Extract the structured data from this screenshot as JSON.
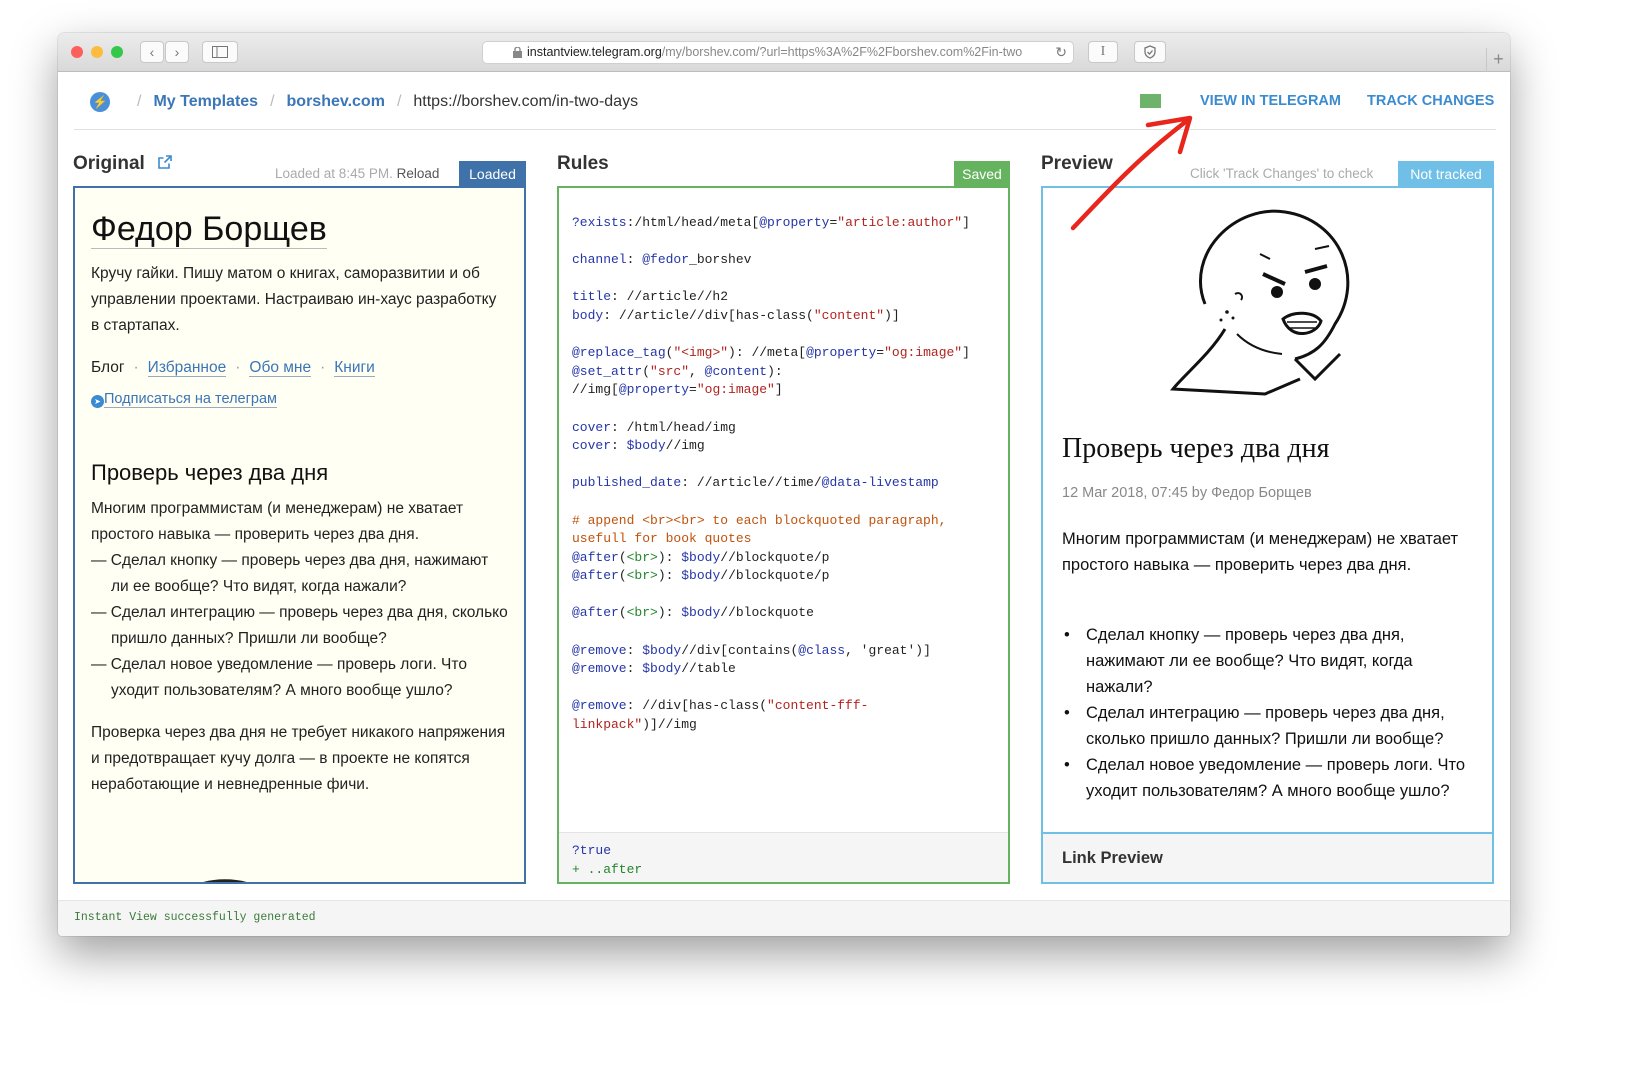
{
  "browser": {
    "url_host": "instantview.telegram.org",
    "url_rest": "/my/borshev.com/?url=https%3A%2F%2Fborshev.com%2Fin-two",
    "reader_label": "I"
  },
  "header": {
    "crumb_templates": "My Templates",
    "crumb_site": "borshev.com",
    "crumb_url": "https://borshev.com/in-two-days",
    "view_in_telegram": "VIEW IN TELEGRAM",
    "track_changes": "TRACK CHANGES",
    "swatch_color": "#6db36c"
  },
  "original": {
    "title": "Original",
    "loaded_text": "Loaded at 8:45 PM.",
    "reload": "Reload",
    "badge": "Loaded",
    "heading": "Федор Борщев",
    "intro": "Кручу гайки. Пишу матом о книгах, саморазвитии и об управлении проектами. Настраиваю ин-хаус разработку в стартапах.",
    "nav": [
      "Блог",
      "Избранное",
      "Обо мне",
      "Книги"
    ],
    "subscribe": "Подписаться на телеграм",
    "article_title": "Проверь через два дня",
    "p1": "Многим программистам (и менеджерам) не хватает простого навыка — проверить через два дня.",
    "items": [
      "— Сделал кнопку — проверь через два дня, нажимают ли ее вообще? Что видят, когда нажали?",
      "— Сделал интеграцию — проверь через два дня, сколько пришло данных? Пришли ли вообще?",
      "— Сделал новое уведомление — проверь логи. Что уходит пользователям? А много вообще ушло?"
    ],
    "p2": "Проверка через два дня не требует никакого напряжения и предотвращает кучу долга — в проекте не копятся неработающие и невнедренные фичи."
  },
  "rules": {
    "title": "Rules",
    "badge": "Saved",
    "footer_line1": "?true",
    "footer_line2": "+ ..after"
  },
  "preview": {
    "title": "Preview",
    "hint": "Click 'Track Changes' to check",
    "badge": "Not tracked",
    "article_title": "Проверь через два дня",
    "meta": "12 Mar 2018, 07:45 by Федор Борщев",
    "body": "Многим программистам (и менеджерам) не хватает простого навыка — проверить через два дня.",
    "items": [
      "Сделал кнопку — проверь через два дня, нажимают ли ее вообще? Что видят, когда нажали?",
      "Сделал интеграцию — проверь через два дня, сколько пришло данных? Пришли ли вообще?",
      "Сделал новое уведомление — проверь логи. Что уходит пользователям? А много вообще ушло?"
    ],
    "link_preview": "Link Preview"
  },
  "status": "Instant View successfully generated",
  "colors": {
    "original_border": "#3e72a9",
    "rules_border": "#66b35f",
    "preview_border": "#6fbfe6",
    "annotation_arrow": "#e8261c"
  }
}
